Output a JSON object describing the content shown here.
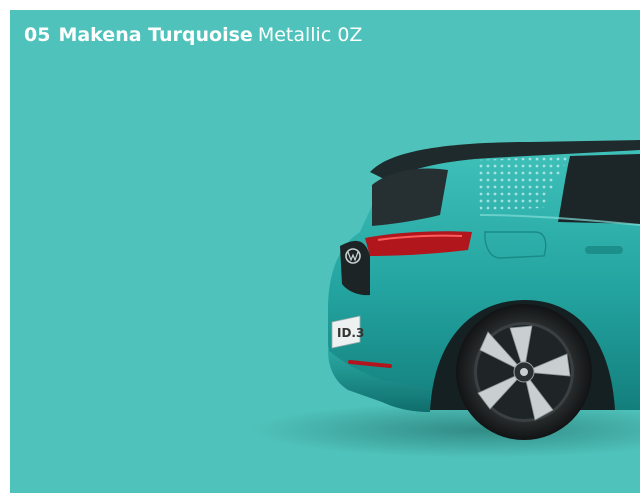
{
  "caption": {
    "number": "05",
    "name": "Makena Turquoise",
    "finish": "Metallic 0Z"
  },
  "colors": {
    "background": "#4fc3bb",
    "body": "#2fa9a4",
    "text": "#ffffff"
  },
  "image": {
    "icon": "car-rear-three-quarter-illustration"
  }
}
